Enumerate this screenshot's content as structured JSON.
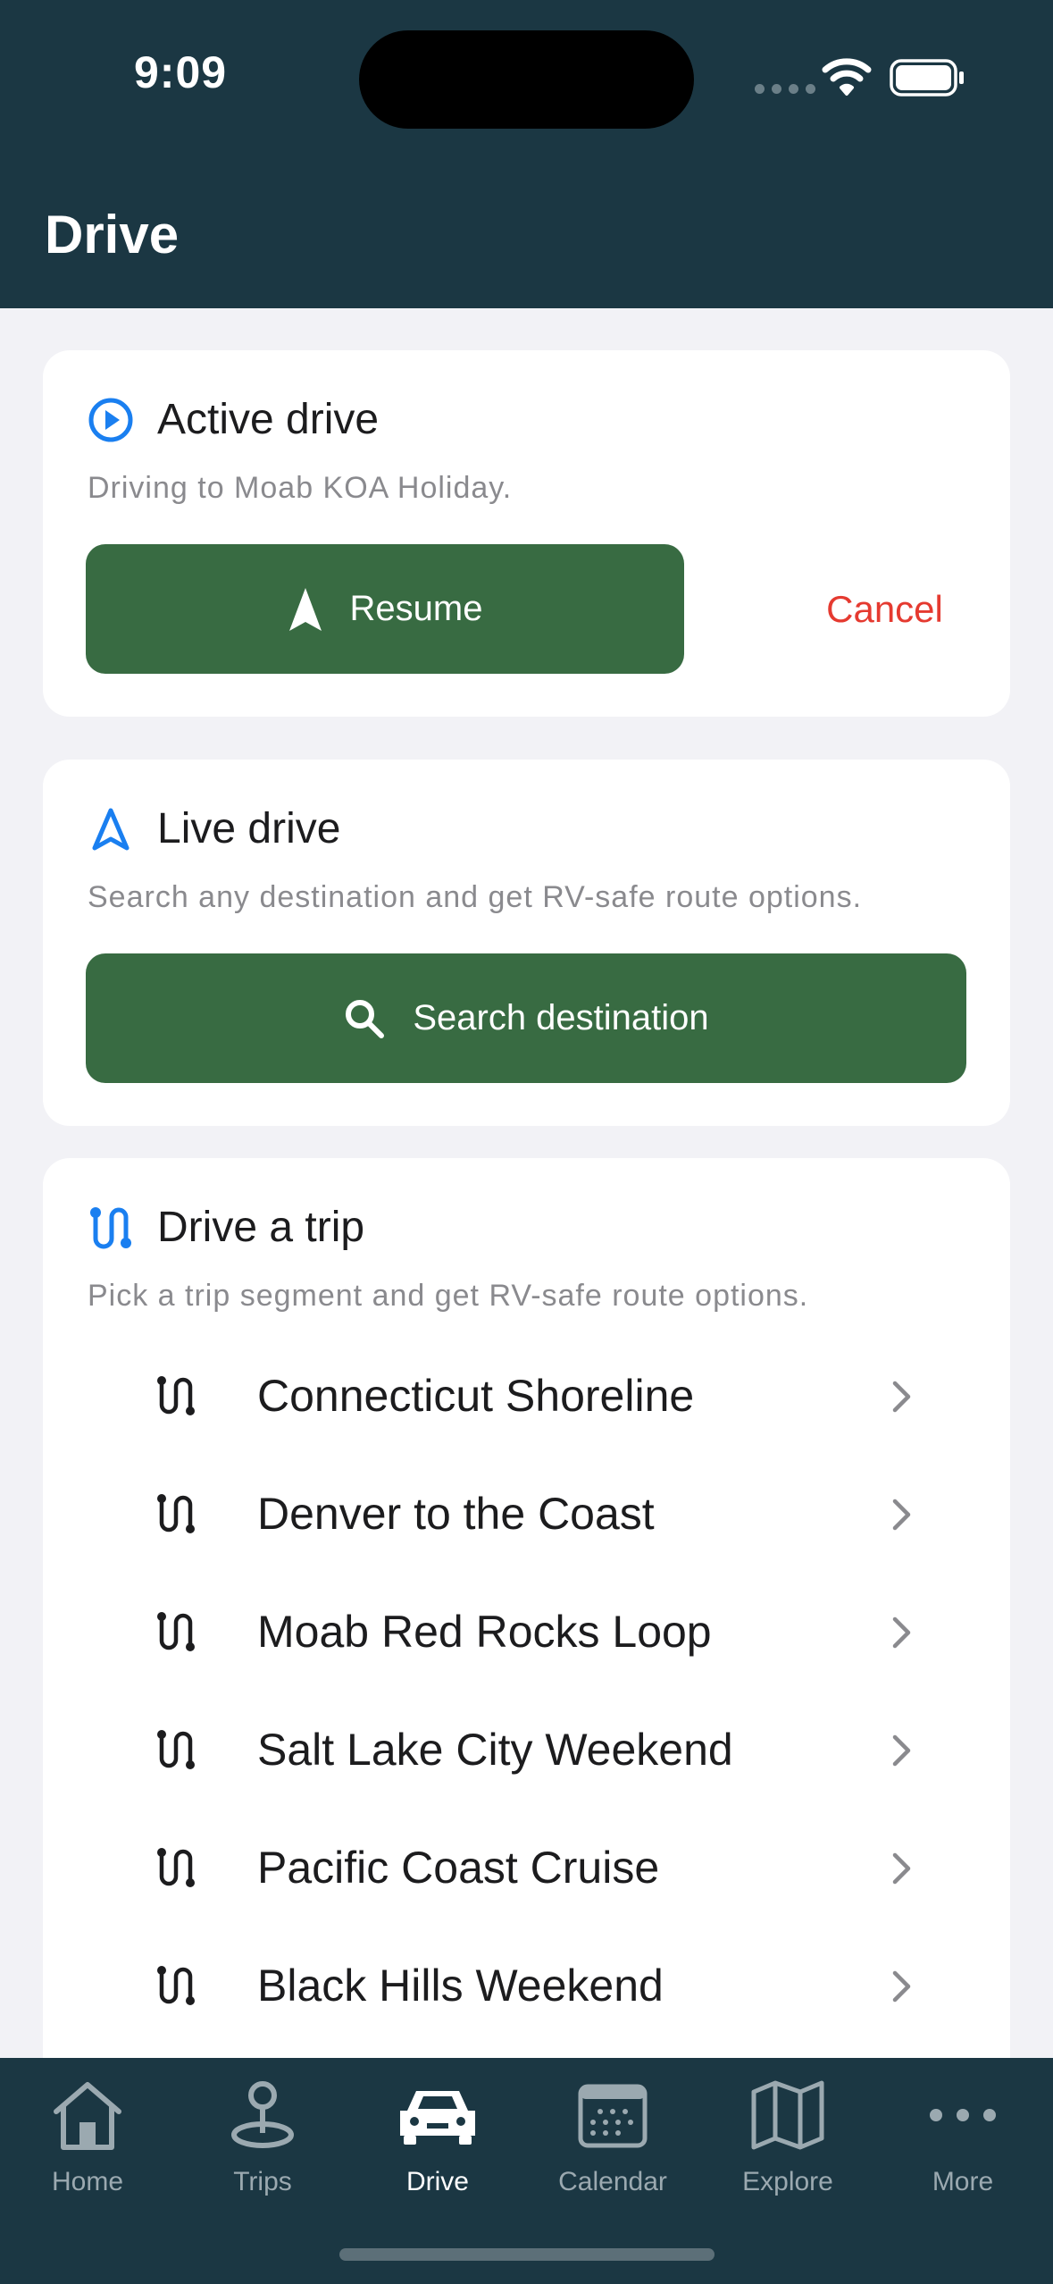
{
  "status_bar": {
    "time": "9:09"
  },
  "header": {
    "title": "Drive"
  },
  "active_drive": {
    "title": "Active drive",
    "subtitle": "Driving to Moab KOA Holiday.",
    "resume_label": "Resume",
    "cancel_label": "Cancel"
  },
  "live_drive": {
    "title": "Live drive",
    "subtitle": "Search any destination and get RV-safe route options.",
    "search_label": "Search destination"
  },
  "drive_trip": {
    "title": "Drive a trip",
    "subtitle": "Pick a trip segment and get RV-safe route options.",
    "trips": [
      {
        "label": "Connecticut Shoreline"
      },
      {
        "label": "Denver to the Coast"
      },
      {
        "label": "Moab Red Rocks Loop"
      },
      {
        "label": "Salt Lake City Weekend"
      },
      {
        "label": "Pacific Coast Cruise"
      },
      {
        "label": "Black Hills Weekend"
      }
    ]
  },
  "tabbar": {
    "tabs": [
      {
        "label": "Home",
        "icon": "house-icon"
      },
      {
        "label": "Trips",
        "icon": "map-pin-icon"
      },
      {
        "label": "Drive",
        "icon": "car-icon",
        "active": true
      },
      {
        "label": "Calendar",
        "icon": "calendar-icon"
      },
      {
        "label": "Explore",
        "icon": "map-icon"
      },
      {
        "label": "More",
        "icon": "ellipsis-icon"
      }
    ]
  },
  "colors": {
    "header_bg": "#1b3743",
    "primary_green": "#386b42",
    "accent_blue": "#1a7ff0",
    "cancel_red": "#e53a30"
  }
}
